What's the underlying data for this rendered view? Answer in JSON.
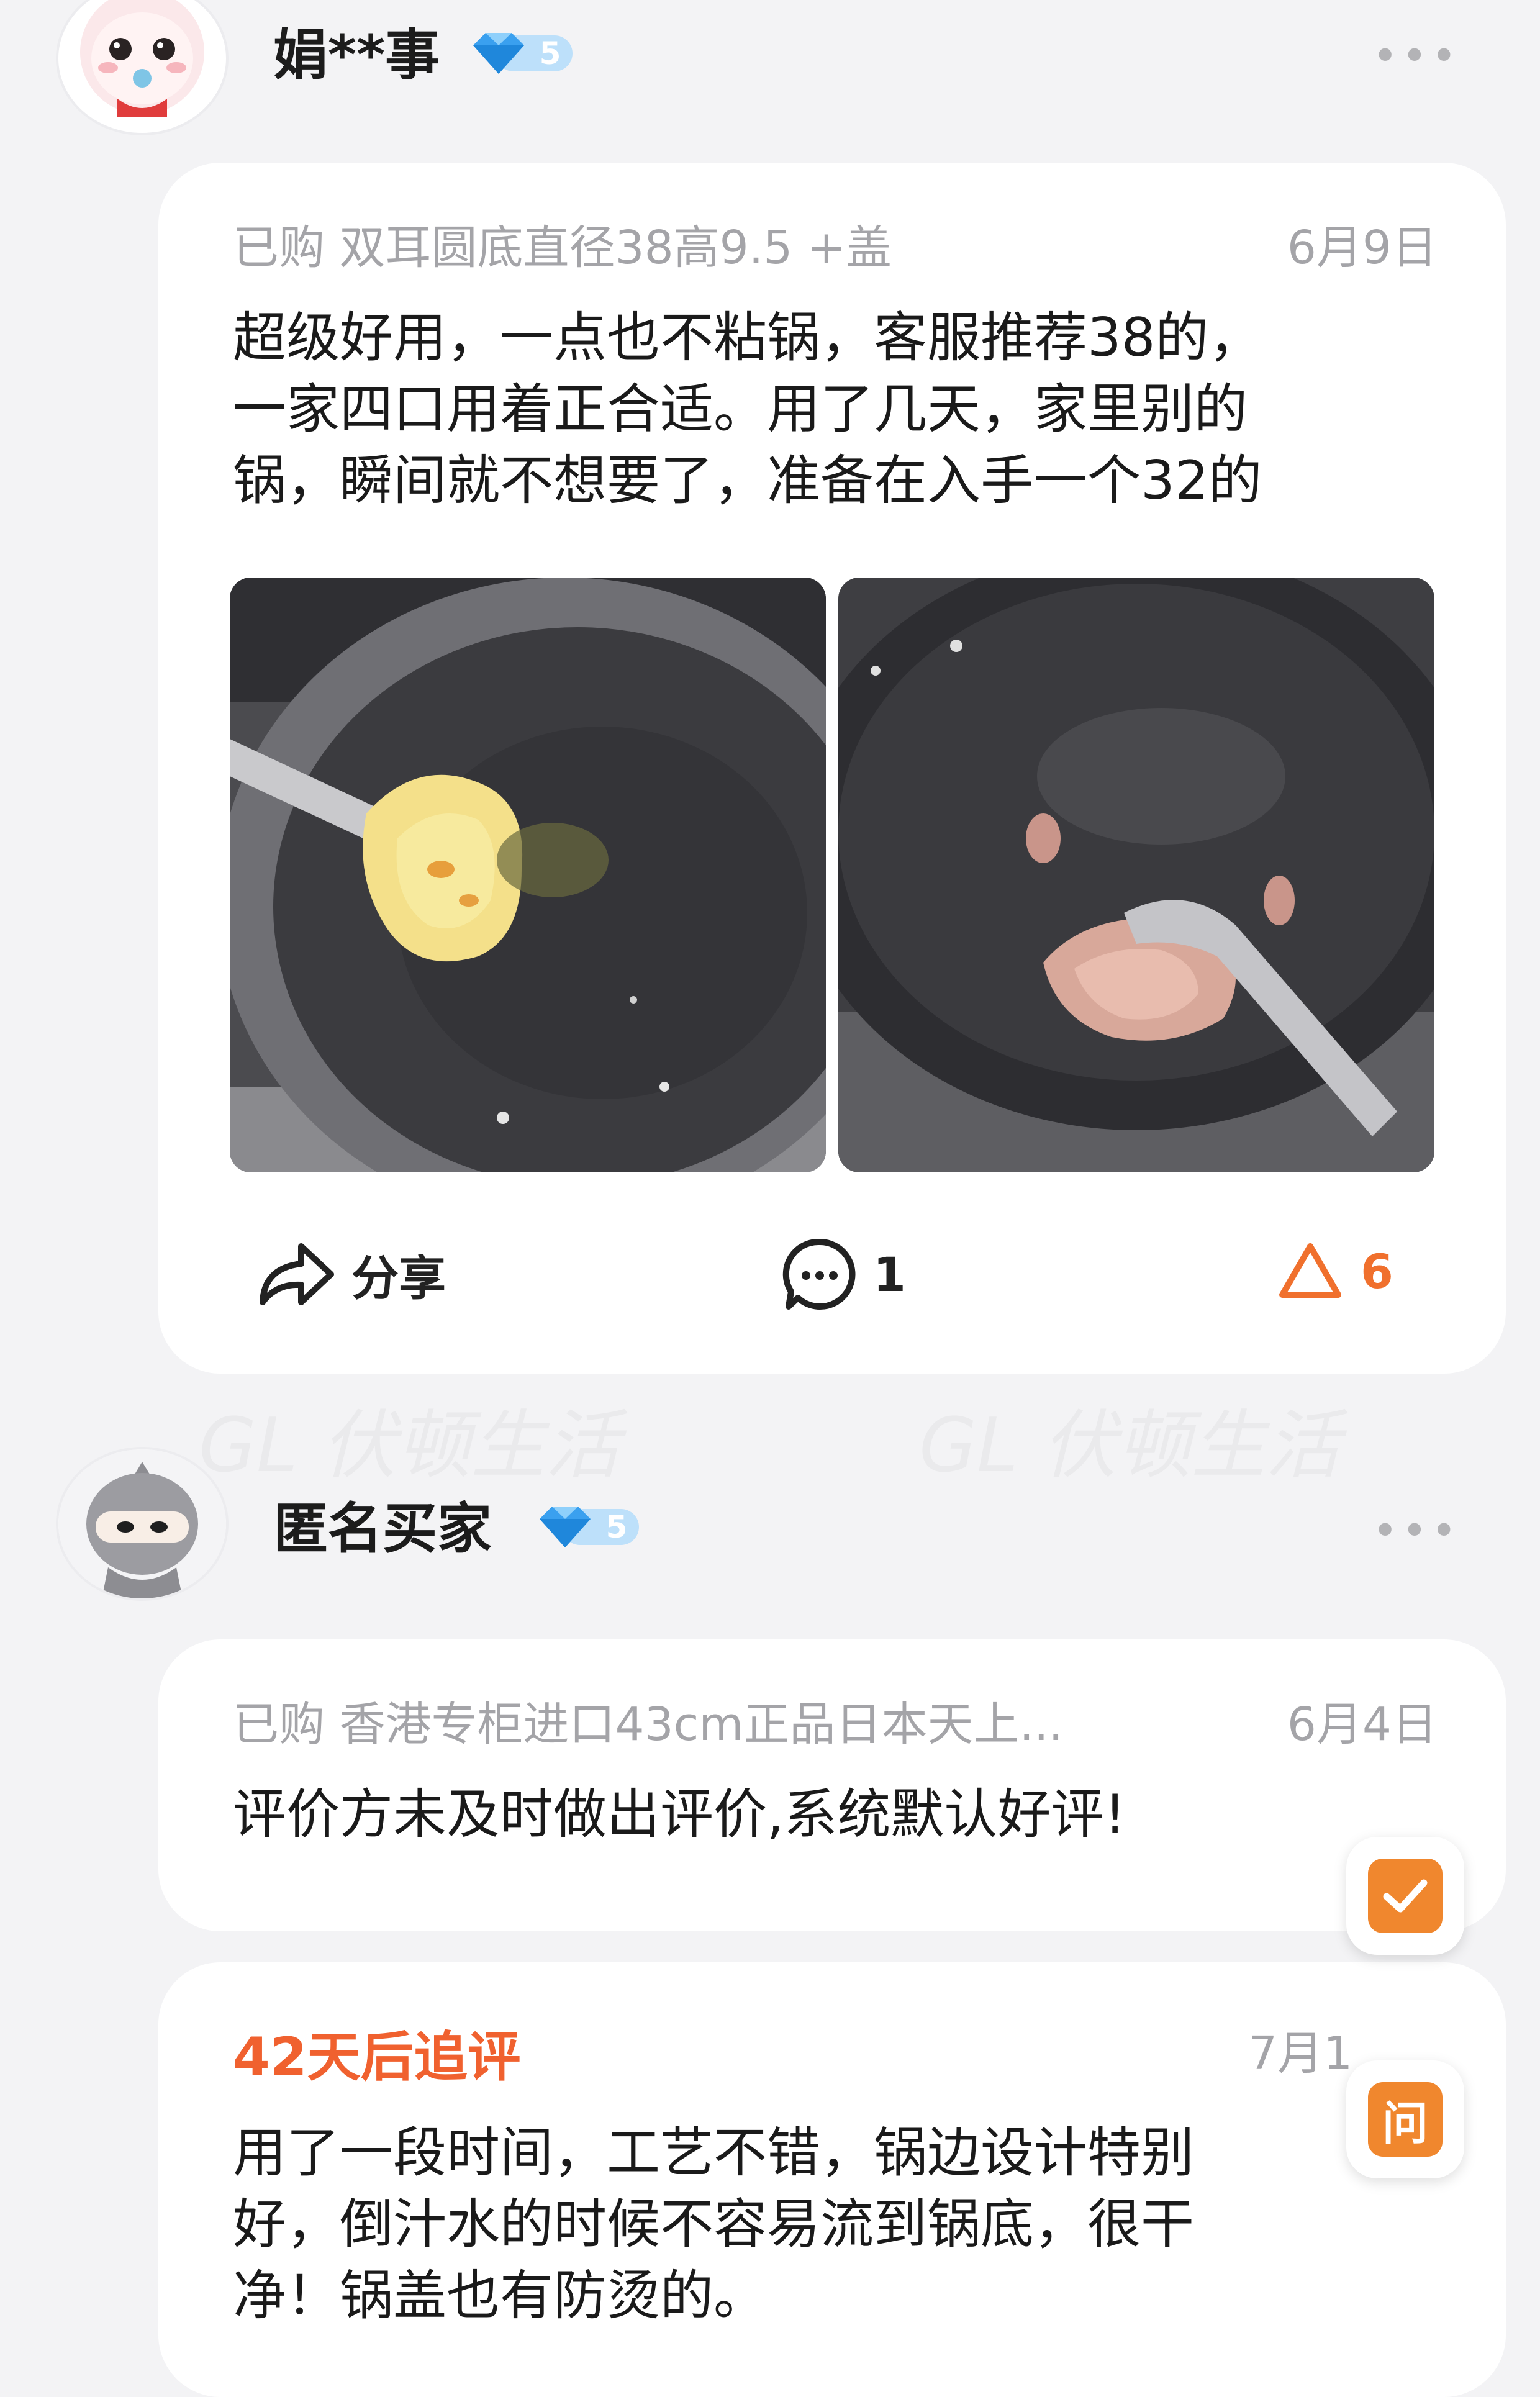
{
  "reviews": [
    {
      "user": {
        "name": "娟**事",
        "level": "5"
      },
      "sku": "已购 双耳圆底直径38高9.5 +盖",
      "date": "6月9日",
      "lines": [
        "超级好用，一点也不粘锅，客服推荐38的，",
        "一家四口用着正合适。用了几天，家里别的",
        "锅，瞬间就不想要了，准备在入手一个32的"
      ],
      "actions": {
        "share": "分享",
        "comments": "1",
        "likes": "6"
      }
    },
    {
      "user": {
        "name": "匿名买家",
        "level": "5"
      },
      "sku": "已购 香港专柜进口43cm正品日本天上...",
      "date": "6月4日",
      "text": "评价方未及时做出评价,系统默认好评!",
      "followup": {
        "title": "42天后追评",
        "date": "7月1",
        "lines": [
          "用了一段时间，工艺不错，锅边设计特别",
          "好，倒汁水的时候不容易流到锅底，很干",
          "净！锅盖也有防烫的。"
        ]
      }
    }
  ],
  "floating": {
    "ask_label": "问"
  },
  "watermark": "GL 伏顿生活",
  "colors": {
    "accent": "#f0702d",
    "followup": "#f0612f",
    "diamond": "#3aa0ef"
  },
  "icons": [
    "share-icon",
    "comment-icon",
    "like-icon",
    "diamond-icon",
    "check-icon"
  ]
}
